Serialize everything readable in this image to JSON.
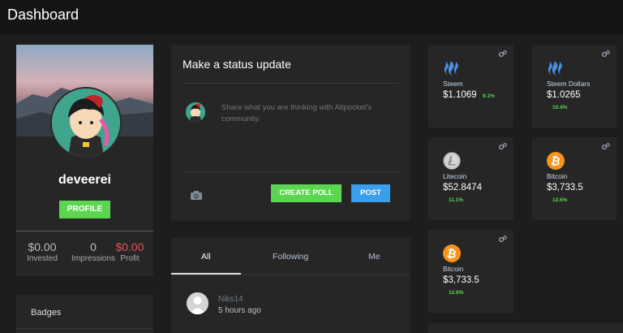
{
  "header": {
    "title": "Dashboard"
  },
  "profile": {
    "username": "deveerei",
    "profile_button": "PROFILE",
    "stats": [
      {
        "value": "$0.00",
        "label": "Invested"
      },
      {
        "value": "0",
        "label": "Impressions"
      },
      {
        "value": "$0.00",
        "label": "Profit"
      }
    ],
    "badges_label": "Badges"
  },
  "status": {
    "title": "Make a status update",
    "placeholder": "Share what you are thinking with Altpocket's community.",
    "create_poll": "CREATE POLL",
    "post": "POST"
  },
  "feed": {
    "tabs": [
      "All",
      "Following",
      "Me"
    ],
    "active_tab": "All",
    "items": [
      {
        "name": "Niks14",
        "time": "5 hours ago"
      }
    ]
  },
  "coins": [
    {
      "name": "Steem",
      "price": "$1.1069",
      "change": "9.1%",
      "icon": "steem-icon"
    },
    {
      "name": "Steem Dollars",
      "price": "$1.0265",
      "change": "10.4%",
      "icon": "steem-icon"
    },
    {
      "name": "Litecoin",
      "price": "$52.8474",
      "change": "11.1%",
      "icon": "litecoin-icon"
    },
    {
      "name": "Bitcoin",
      "price": "$3,733.5",
      "change": "12.6%",
      "icon": "bitcoin-icon"
    },
    {
      "name": "Bitcoin",
      "price": "$3,733.5",
      "change": "12.6%",
      "icon": "bitcoin-icon"
    }
  ],
  "colors": {
    "green": "#5cd651",
    "blue": "#3a9eea",
    "red": "#e05252",
    "card": "#262626",
    "bg": "#1d1d1d"
  }
}
